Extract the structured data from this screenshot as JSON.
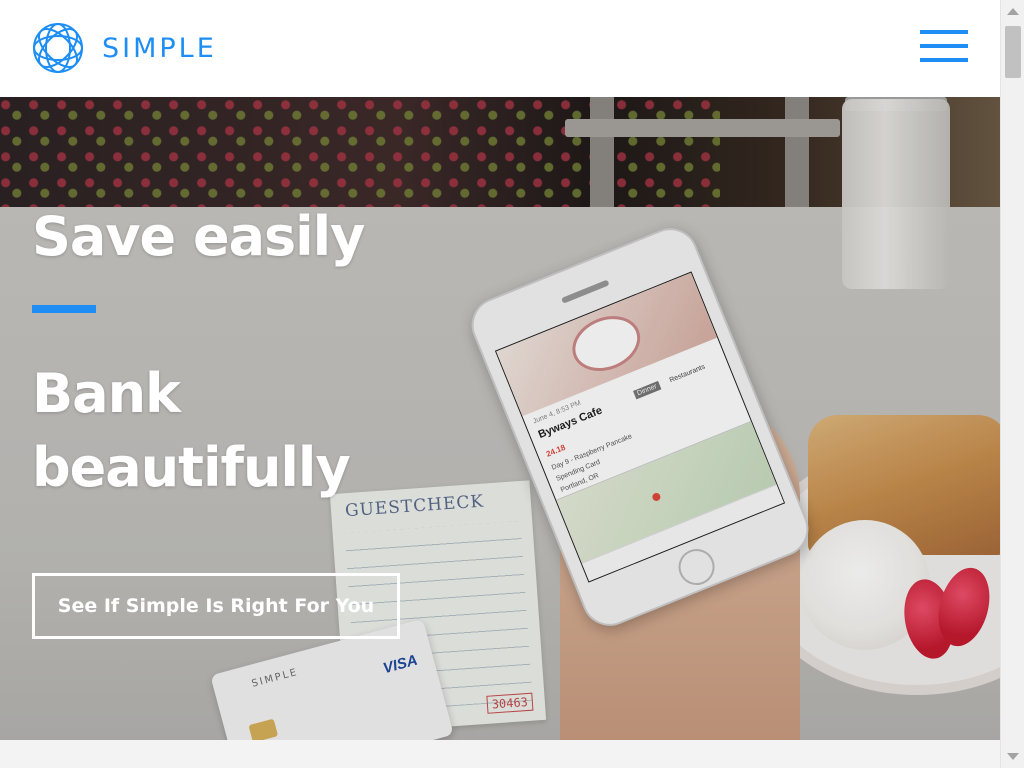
{
  "header": {
    "brand": "SIMPLE",
    "logo_icon": "simple-logo-icon",
    "menu_icon": "hamburger-menu-icon",
    "accent_color": "#1e8ef4"
  },
  "hero": {
    "headline": "Save easily",
    "subheadline": "Bank beautifully",
    "cta_label": "See If Simple Is Right For You"
  },
  "photo": {
    "guest_check_title": "GUESTCHECK",
    "guest_check_number": "30463",
    "card_brand": "SIMPLE",
    "card_network": "VISA",
    "phone_app": {
      "date": "June 4, 8:53 PM",
      "merchant": "Byways Cafe",
      "tag": "Dinner",
      "category": "Restaurants",
      "amount": "24.18",
      "memo": "Day 9 - Raspberry Pancake",
      "card": "Spending Card",
      "location": "Portland, OR"
    }
  }
}
